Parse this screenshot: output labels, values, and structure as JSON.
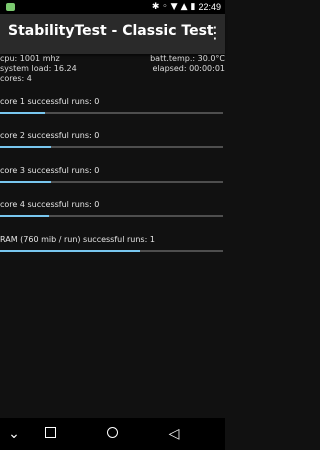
{
  "status_bar": {
    "time": "22:49",
    "icons": [
      "android-notification-icon",
      "bluetooth-icon",
      "mute-icon",
      "wifi-icon",
      "signal-icon",
      "battery-icon"
    ]
  },
  "app": {
    "title": "StabilityTest - Classic Test",
    "menu_icon": "more-vert-icon"
  },
  "info": {
    "cpu": "cpu: 1001 mhz",
    "batt_temp": "batt.temp.: 30.0°C",
    "system_load": "system load: 16.24",
    "elapsed": "elapsed: 00:00:01",
    "cores": "cores: 4"
  },
  "tests": [
    {
      "label": "core 1 successful runs: 0",
      "progress": 0.2
    },
    {
      "label": "core 2 successful runs: 0",
      "progress": 0.23
    },
    {
      "label": "core 3 successful runs: 0",
      "progress": 0.23
    },
    {
      "label": "core 4 successful runs: 0",
      "progress": 0.22
    },
    {
      "label": "RAM (760 mib / run) successful runs: 1",
      "progress": 0.63
    }
  ],
  "colors": {
    "progress_fill": "#79c7ef",
    "progress_track": "#4e4e4e",
    "app_bar": "#2a2a2a",
    "background": "#111111"
  },
  "navbar": {
    "icons": [
      "collapse-icon",
      "recents-icon",
      "home-icon",
      "back-icon"
    ]
  }
}
